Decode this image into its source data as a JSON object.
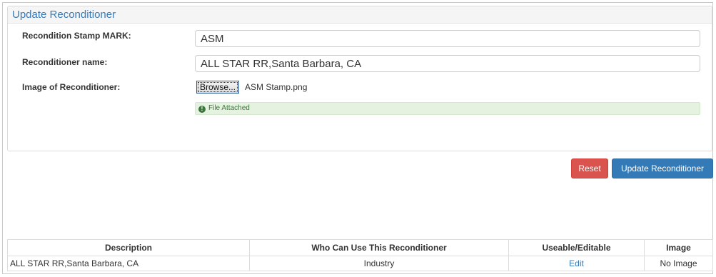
{
  "panel": {
    "title": "Update Reconditioner"
  },
  "form": {
    "stamp_mark": {
      "label": "Recondition Stamp MARK:",
      "value": "ASM"
    },
    "name": {
      "label": "Reconditioner name:",
      "value": "ALL STAR RR,Santa Barbara, CA"
    },
    "image": {
      "label": "Image of Reconditioner:",
      "browse_label": "Browse...",
      "file_name": "ASM Stamp.png"
    },
    "alert": {
      "icon": "info-circle-icon",
      "text": "File Attached",
      "color": "#3c763d"
    }
  },
  "actions": {
    "reset_label": "Reset",
    "update_label": "Update Reconditioner",
    "reset_color": "#d9534f",
    "update_color": "#337ab7"
  },
  "table": {
    "headers": [
      "Description",
      "Who Can Use This Reconditioner",
      "Useable/Editable",
      "Image"
    ],
    "rows": [
      [
        "ALL STAR RR,Santa Barbara, CA",
        "Industry",
        "Edit",
        "No Image"
      ]
    ]
  },
  "colors": {
    "accent": "#3a7ab5",
    "link": "#337ab7"
  }
}
